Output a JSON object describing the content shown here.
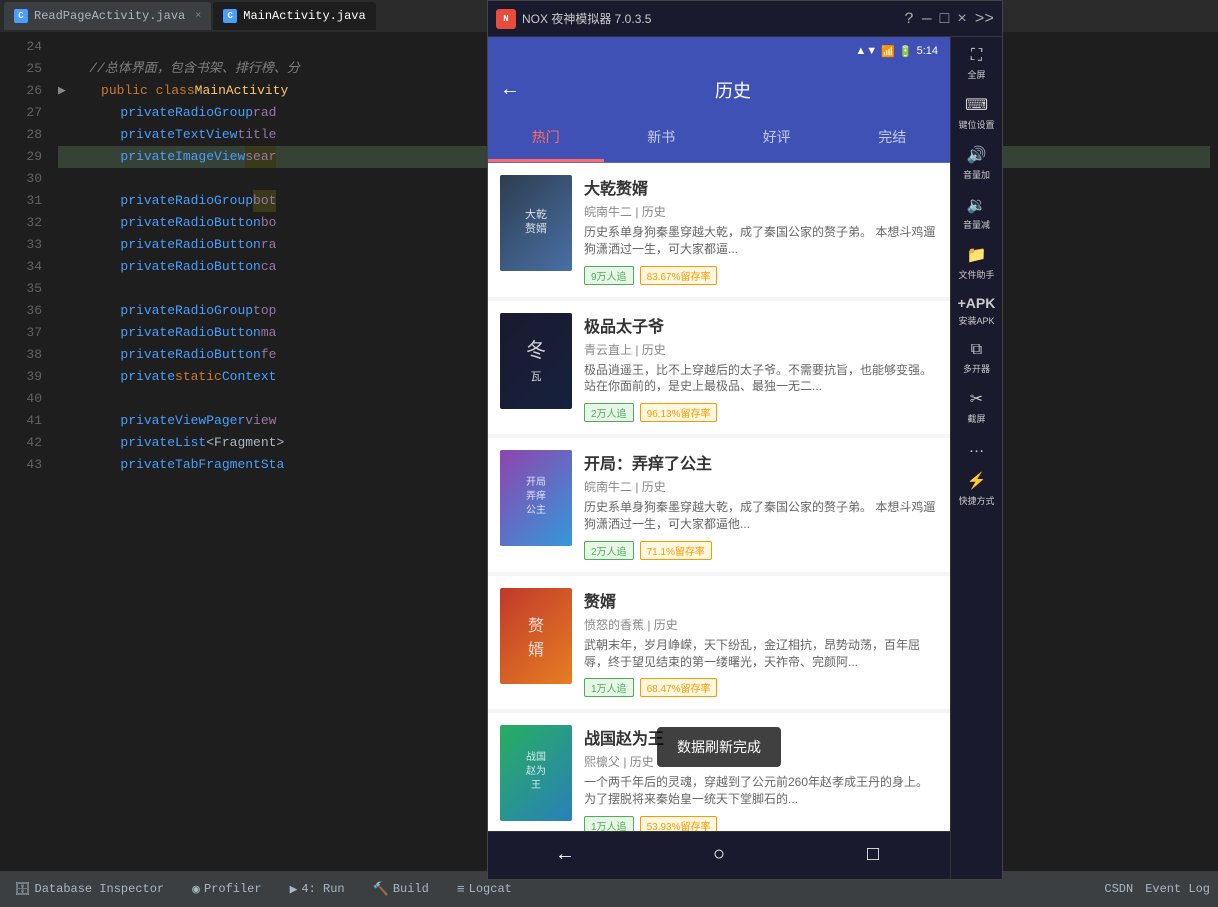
{
  "tabs": [
    {
      "label": "ReadPageActivity.java",
      "icon": "C",
      "active": false
    },
    {
      "label": "MainActivity.java",
      "icon": "C",
      "active": true
    }
  ],
  "code": {
    "lines": [
      {
        "num": "24",
        "content": "",
        "type": "empty"
      },
      {
        "num": "25",
        "content": "    //总体界面，包含书架、排行榜、分",
        "type": "comment"
      },
      {
        "num": "26",
        "content": "    public class MainActivity ",
        "type": "code"
      },
      {
        "num": "27",
        "content": "        private RadioGroup rad",
        "type": "code"
      },
      {
        "num": "28",
        "content": "        private TextView title",
        "type": "code"
      },
      {
        "num": "29",
        "content": "        private ImageView sear",
        "type": "code",
        "highlight": true
      },
      {
        "num": "30",
        "content": "",
        "type": "empty"
      },
      {
        "num": "31",
        "content": "        private RadioGroup bot",
        "type": "code"
      },
      {
        "num": "32",
        "content": "        private RadioButton bo",
        "type": "code"
      },
      {
        "num": "33",
        "content": "        private RadioButton ra",
        "type": "code"
      },
      {
        "num": "34",
        "content": "        private RadioButton ca",
        "type": "code"
      },
      {
        "num": "35",
        "content": "",
        "type": "empty"
      },
      {
        "num": "36",
        "content": "        private RadioGroup top",
        "type": "code"
      },
      {
        "num": "37",
        "content": "        private RadioButton ma",
        "type": "code"
      },
      {
        "num": "38",
        "content": "        private RadioButton fe",
        "type": "code"
      },
      {
        "num": "39",
        "content": "        private static Context",
        "type": "code"
      },
      {
        "num": "40",
        "content": "",
        "type": "empty"
      },
      {
        "num": "41",
        "content": "        private ViewPager view",
        "type": "code"
      },
      {
        "num": "42",
        "content": "        private List<Fragment>",
        "type": "code"
      },
      {
        "num": "43",
        "content": "        private TabFragmentSta",
        "type": "code"
      }
    ]
  },
  "emulator": {
    "title": "NOX 夜神模拟器 7.0.3.5",
    "statusbar": {
      "time": "5:14",
      "icons": [
        "▲",
        "▼",
        "📶",
        "🔋"
      ]
    },
    "app": {
      "title": "历史",
      "tabs": [
        "热门",
        "新书",
        "好评",
        "完结"
      ],
      "activeTab": "热门"
    },
    "books": [
      {
        "title": "大乾赘婿",
        "author": "皖南牛二 | 历史",
        "desc": "历史系单身狗秦墨穿越大乾，成了秦国公家的赘子弟。\n本想斗鸡遛狗潇洒过一生，可大家都逼...",
        "tags": [
          "9万人追",
          "83.67%留存率"
        ],
        "coverClass": "cover-1",
        "coverText": "大乾\n赘婿"
      },
      {
        "title": "极品太子爷",
        "author": "青云直上 | 历史",
        "desc": "极品逍遥王，比不上穿越后的太子爷。不需要抗旨，也能够变强。\n站在你面前的，是史上最极品、最独一无二...",
        "tags": [
          "2万人追",
          "96.13%留存率"
        ],
        "coverClass": "cover-2",
        "coverText": "冬\n瓦"
      },
      {
        "title": "开局：弄痒了公主",
        "author": "皖南牛二 | 历史",
        "desc": "历史系单身狗秦墨穿越大乾，成了秦国公家的赘子弟。\n本想斗鸡遛狗潇洒过一生，可大家都逼他...",
        "tags": [
          "2万人追",
          "71.1%留存率"
        ],
        "coverClass": "cover-3",
        "coverText": "开局\n弄痒\n公主"
      },
      {
        "title": "赘婿",
        "author": "愤怒的香蕉 | 历史",
        "desc": "武朝末年，岁月峥嵘，天下纷乱，金辽相抗，昂势动荡，百年屈辱，终于望见结束的第一缕曙光，天祚帝、完颜阿...",
        "tags": [
          "1万人追",
          "68.47%留存率"
        ],
        "coverClass": "cover-4",
        "coverText": "赘\n婿"
      },
      {
        "title": "战国赵为王",
        "author": "熙檩父 | 历史",
        "desc": "一个两千年后的灵魂，穿越到了公元前260年赵孝成王丹的身上。\n为了摆脱将来秦始皇一统天下堂脚石的...",
        "tags": [
          "1万人追",
          "53.93%留存率"
        ],
        "coverClass": "cover-5",
        "coverText": "战国\n赵为\n王"
      }
    ],
    "toast": "数据刷新完成",
    "sidebar": [
      {
        "icon": "⛶",
        "label": "全屏"
      },
      {
        "icon": "⌨",
        "label": "键位设置"
      },
      {
        "icon": "🔊",
        "label": "音量加"
      },
      {
        "icon": "🔉",
        "label": "音量减"
      },
      {
        "icon": "📁",
        "label": "文件助手"
      },
      {
        "icon": "+",
        "label": "安装APK"
      },
      {
        "icon": "⧉",
        "label": "多开器"
      },
      {
        "icon": "✂",
        "label": "截屏"
      },
      {
        "icon": "…",
        "label": ""
      },
      {
        "icon": "⚡",
        "label": "快捷方式"
      }
    ],
    "nav": [
      {
        "icon": "←",
        "label": "back"
      },
      {
        "icon": "○",
        "label": "home"
      },
      {
        "icon": "□",
        "label": "recent"
      }
    ]
  },
  "bottomBar": {
    "items": [
      {
        "icon": "🗄",
        "label": "Database Inspector"
      },
      {
        "icon": "◉",
        "label": "Profiler"
      },
      {
        "icon": "▶",
        "label": "4: Run"
      },
      {
        "icon": "🔨",
        "label": "Build"
      },
      {
        "icon": "≡",
        "label": "Logcat"
      }
    ],
    "rightItems": [
      "CSDN",
      "Event Log"
    ]
  }
}
